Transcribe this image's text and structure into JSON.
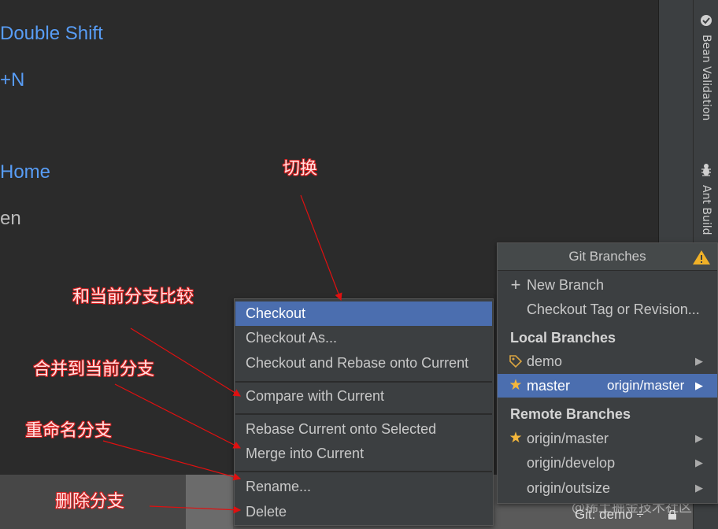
{
  "editor": {
    "hints": [
      {
        "text": "Double Shift",
        "color": "#589df6"
      },
      {
        "text": "+N",
        "color": "#589df6"
      },
      {
        "text": "Home",
        "color": "#589df6"
      },
      {
        "text": "en",
        "color": "#bbbbbb"
      }
    ]
  },
  "tool_strip": {
    "tabs": [
      {
        "label": "Bean Validation",
        "icon": "bean-validation-icon"
      },
      {
        "label": "Ant Build",
        "icon": "ant-icon"
      }
    ]
  },
  "context_menu": {
    "items": [
      {
        "label": "Checkout",
        "selected": true
      },
      {
        "label": "Checkout As..."
      },
      {
        "label": "Checkout and Rebase onto Current"
      },
      {
        "label": "Compare with Current"
      },
      {
        "label": "Rebase Current onto Selected"
      },
      {
        "label": "Merge into Current"
      },
      {
        "label": "Rename..."
      },
      {
        "label": "Delete"
      }
    ]
  },
  "git_popup": {
    "title": "Git Branches",
    "actions": [
      {
        "label": "New Branch",
        "icon": "plus-icon"
      },
      {
        "label": "Checkout Tag or Revision..."
      }
    ],
    "local_header": "Local Branches",
    "local_branches": [
      {
        "name": "demo",
        "icon": "tag-icon",
        "tracking": ""
      },
      {
        "name": "master",
        "icon": "star-icon",
        "tracking": "origin/master",
        "selected": true
      }
    ],
    "remote_header": "Remote Branches",
    "remote_branches": [
      {
        "name": "origin/master",
        "icon": "star-icon"
      },
      {
        "name": "origin/develop"
      },
      {
        "name": "origin/outsize"
      }
    ]
  },
  "status_bar": {
    "git_branch": "Git: demo ÷"
  },
  "watermark": "@稀土掘金技术社区",
  "annotations": [
    {
      "text": "切换"
    },
    {
      "text": "和当前分支比较"
    },
    {
      "text": "合并到当前分支"
    },
    {
      "text": "重命名分支"
    },
    {
      "text": "删除分支"
    }
  ]
}
